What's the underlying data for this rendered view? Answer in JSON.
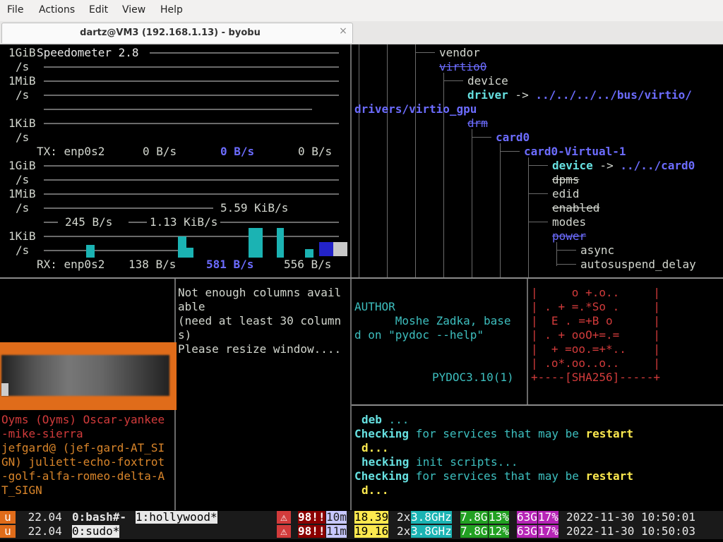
{
  "menu": {
    "file": "File",
    "actions": "Actions",
    "edit": "Edit",
    "view": "View",
    "help": "Help"
  },
  "tab": {
    "title": "dartz@VM3 (192.168.1.13) - byobu",
    "close": "×"
  },
  "speedometer": {
    "title": "Speedometer 2.8",
    "tx": {
      "u1": "1GiB",
      "u2": "/s",
      "u3": "1MiB",
      "u4": "/s",
      "u5": "1KiB",
      "u6": "/s",
      "label": "TX: enp0s2",
      "v1": "0 B/s",
      "v2": "0 B/s",
      "v3": "0 B/s"
    },
    "rx": {
      "u1": "1GiB",
      "u2": "/s",
      "u3": "1MiB",
      "u4": "/s",
      "u5": "1KiB",
      "u6": "/s",
      "label": "RX: enp0s2",
      "v1": "138 B/s",
      "v2": "581 B/s",
      "v3": "556 B/s",
      "m1": "5.59 KiB/s",
      "m2": "245 B/s",
      "m3": "1.13 KiB/s"
    }
  },
  "tree": {
    "vendor": "vendor",
    "virtio0": "virtio0",
    "device": "device",
    "driver": "driver",
    "arrow1": " -> ",
    "driver_path1": "../../../../bus/virtio/",
    "driver_path2": "drivers/virtio_gpu",
    "drm": "drm",
    "card0": "card0",
    "card0_virtual": "card0-Virtual-1",
    "device2": "device",
    "arrow2": " -> ",
    "device2_path": "../../card0",
    "dpms": "dpms",
    "edid": "edid",
    "enabled": "enabled",
    "modes": "modes",
    "power": "power",
    "async": "async",
    "autosuspend": "autosuspend_delay"
  },
  "resize": {
    "l1": "Not enough columns avail",
    "l2": "able",
    "l3": "(need at least 30 column",
    "l4": "s)",
    "l5": "Please resize window...."
  },
  "pydoc": {
    "author": "AUTHOR",
    "l1": "      Moshe Zadka, base",
    "l2": "d on \"pydoc --help\"",
    "footer": "PYDOC3.10(1)"
  },
  "randomart": [
    "|     o +.o..     |",
    "| . + =.*So .     |",
    "|  E . =+B o      |",
    "| . + ooO+=.=     |",
    "|  + =oo.=+*..    |",
    "| .o*.oo..o..     |",
    "+----[SHA256]-----+"
  ],
  "update": {
    "deb": "deb",
    "deb_rest": " ...",
    "checking": "Checking",
    "for_services": " for services that may be ",
    "restart": "restart",
    "d": "d...",
    "hecking": "hecking",
    "init_scripts": " init scripts..."
  },
  "chat": {
    "l1": "Oyms (Oyms) Oscar-yankee",
    "l2": "-mike-sierra",
    "l3": "jefgard@ (jef-gard-AT_SI",
    "l4": "GN) juliett-echo-foxtrot",
    "l5": "-golf-alfa-romeo-delta-A",
    "l6": "T_SIGN"
  },
  "status": {
    "row1": {
      "u": "u",
      "ver": " 22.04 ",
      "win0": "0:bash#-",
      "win1": "1:hollywood*",
      "warn": "⚠",
      "updates": "98!!",
      "uptime": "10m",
      "load": "18.39",
      "cpu": "2x",
      "ghz": "3.8GHz",
      "mem": "7.8G",
      "memp": "13%",
      "disk": "63G",
      "diskp": "17%",
      "datetime": "2022-11-30 10:50:01"
    },
    "row2": {
      "u": "u",
      "ver": " 22.04 ",
      "win0": "0:sudo*",
      "warn": "⚠",
      "updates": "98!!",
      "uptime": "11m",
      "load": "19.16",
      "cpu": "2x",
      "ghz": "3.8GHz",
      "mem": "7.8G",
      "memp": "12%",
      "disk": "63G",
      "diskp": "17%",
      "datetime": "2022-11-30 10:50:03"
    }
  },
  "colors": {
    "accent_orange": "#e06c1a",
    "chat_red": "#d23b3b",
    "cyan": "#3dbfbf",
    "blue": "#6c6cff"
  }
}
